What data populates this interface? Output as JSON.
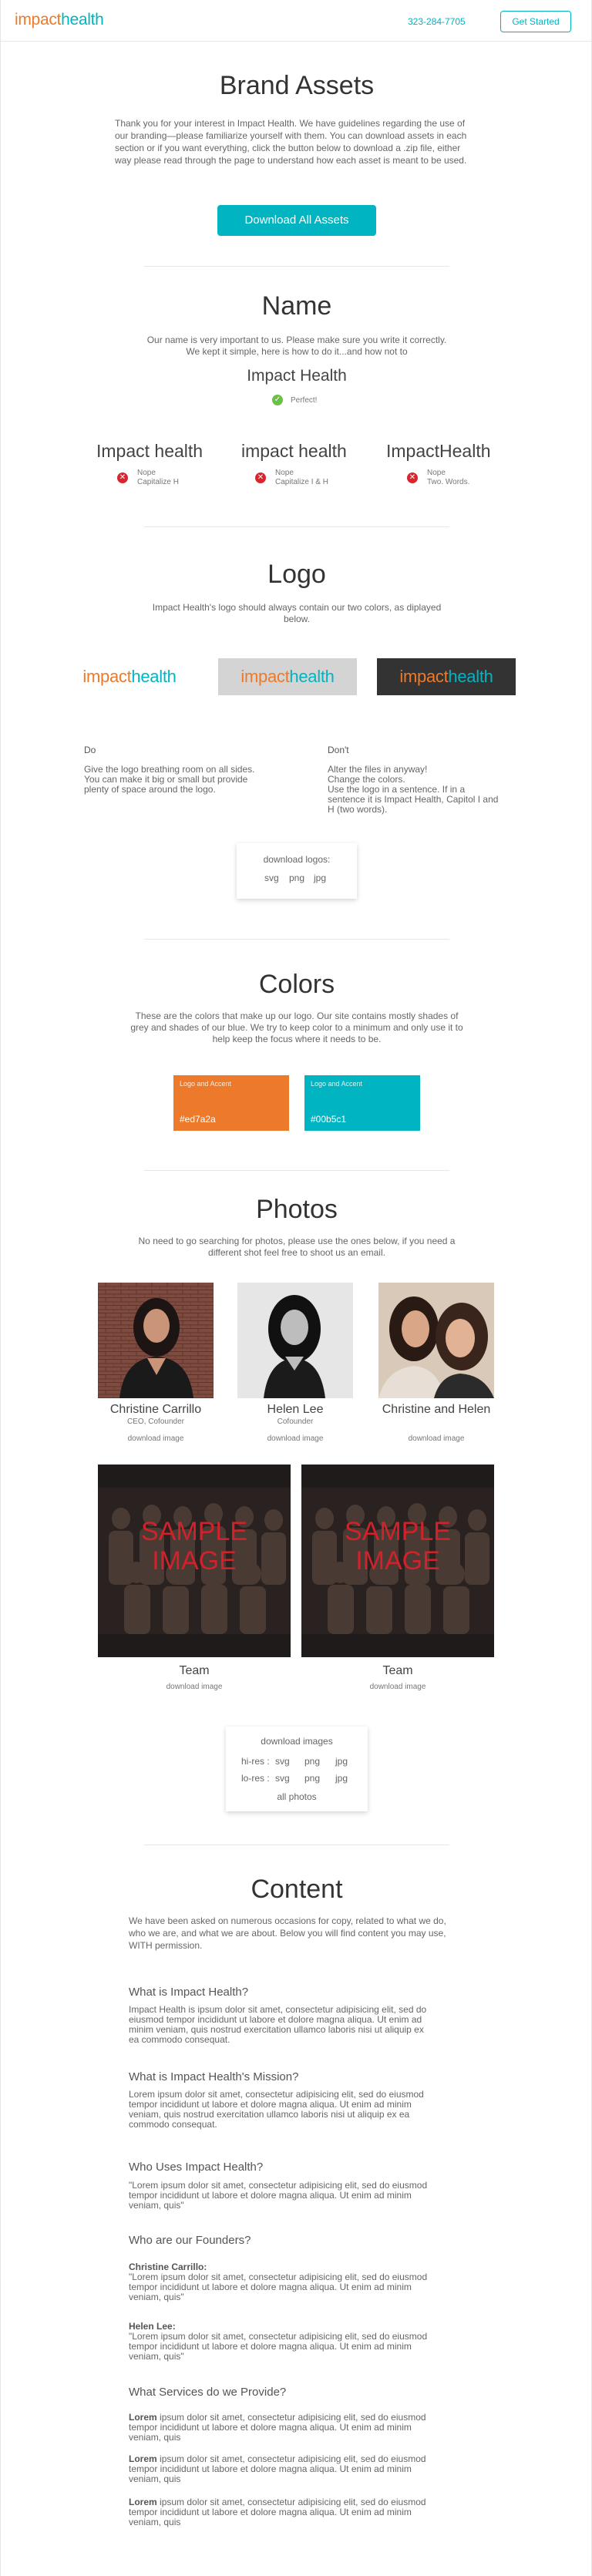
{
  "header": {
    "logo_part1": "impact",
    "logo_part2": "health",
    "phone": "323-284-7705",
    "cta_label": "Get Started"
  },
  "brand": {
    "title": "Brand Assets",
    "intro": "Thank you for your interest in Impact Health. We have guidelines regarding the use of our branding—please familiarize yourself with them. You can download assets in each section or if you want everything, click the button below to download a .zip file, either way please read through the page to understand how each asset is meant to be used.",
    "download_all_label": "Download All Assets"
  },
  "name_section": {
    "title": "Name",
    "intro": "Our name is very important to us. Please make sure you write it correctly. We kept it simple, here is how to do it...and how not to",
    "correct": "Impact Health",
    "correct_note": "Perfect!",
    "wrong": [
      {
        "text": "Impact health",
        "verdict": "Nope",
        "reason": "Capitalize H"
      },
      {
        "text": "impact health",
        "verdict": "Nope",
        "reason": "Capitalize I & H"
      },
      {
        "text": "ImpactHealth",
        "verdict": "Nope",
        "reason": "Two. Words."
      }
    ]
  },
  "logo_section": {
    "title": "Logo",
    "intro": "Impact Health's logo should always contain our two colors, as diplayed below.",
    "logo_part1": "impact",
    "logo_part2": "health",
    "do_heading": "Do",
    "do_text": "Give the logo breathing room on all sides. You can make it big or small but provide plenty of space around the logo.",
    "dont_heading": "Don't",
    "dont_lines": [
      "Alter the files in anyway!",
      "Change the colors.",
      "Use the logo in a sentence. If in a sentence it is Impact Health, Capitol I and H (two words)."
    ],
    "download_title": "download logos:",
    "formats": [
      "svg",
      "png",
      "jpg"
    ]
  },
  "colors_section": {
    "title": "Colors",
    "intro": "These are the colors that make up our logo. Our site contains mostly shades of grey and shades of our blue. We try to keep color to a minimum and only use it to help keep the focus where it needs to be.",
    "swatches": [
      {
        "label": "Logo and Accent",
        "hex": "#ed7a2a",
        "color": "#ed7a2a"
      },
      {
        "label": "Logo and Accent",
        "hex": "#00b5c1",
        "color": "#00b5c1"
      }
    ]
  },
  "photos_section": {
    "title": "Photos",
    "intro": "No need to go searching for photos, please use the ones below, if you need a different shot feel free to shoot us an email.",
    "people": [
      {
        "name": "Christine Carrillo",
        "role": "CEO, Cofounder",
        "download": "download image"
      },
      {
        "name": "Helen Lee",
        "role": "Cofounder",
        "download": "download image"
      },
      {
        "name": "Christine and Helen",
        "role": "",
        "download": "download image"
      }
    ],
    "teams": [
      {
        "stamp": "SAMPLE IMAGE",
        "name": "Team",
        "download": "download image"
      },
      {
        "stamp": "SAMPLE IMAGE",
        "name": "Team",
        "download": "download image"
      }
    ],
    "download_box": {
      "title": "download images",
      "hires_label": "hi-res :",
      "lores_label": "lo-res :",
      "formats": [
        "svg",
        "png",
        "jpg"
      ],
      "all": "all photos"
    }
  },
  "content_section": {
    "title": "Content",
    "intro": "We have been asked on numerous occasions for copy, related to what we do, who we are, and what we are about. Below you will find content you may use, WITH permission.",
    "q1": "What is Impact Health?",
    "a1": "Impact Health is ipsum dolor sit amet, consectetur adipisicing elit, sed do eiusmod tempor incididunt ut labore et dolore magna aliqua. Ut enim ad minim veniam, quis nostrud exercitation ullamco laboris nisi ut aliquip ex ea commodo consequat.",
    "q2": "What is Impact Health's Mission?",
    "a2": "Lorem ipsum dolor sit amet, consectetur adipisicing elit, sed do eiusmod tempor incididunt ut labore et dolore magna aliqua. Ut enim ad minim veniam, quis nostrud exercitation ullamco laboris nisi ut aliquip ex ea commodo consequat.",
    "q3": "Who Uses Impact Health?",
    "a3": "\"Lorem ipsum dolor sit amet, consectetur adipisicing elit, sed do eiusmod tempor incididunt ut labore et dolore magna aliqua. Ut enim ad minim veniam, quis\"",
    "q4": "Who are our Founders?",
    "founder1_name": "Christine Carrillo:",
    "founder1_text": "\"Lorem ipsum dolor sit amet, consectetur adipisicing elit, sed do eiusmod tempor incididunt ut labore et dolore magna aliqua. Ut enim ad minim veniam, quis\"",
    "founder2_name": "Helen Lee:",
    "founder2_text": "\"Lorem ipsum dolor sit amet, consectetur adipisicing elit, sed do eiusmod tempor incididunt ut labore et dolore magna aliqua. Ut enim ad minim veniam, quis\"",
    "q5": "What Services do we Provide?",
    "services": [
      {
        "lead": "Lorem",
        "text": "ipsum dolor sit amet, consectetur adipisicing elit, sed do eiusmod tempor incididunt ut labore et dolore magna aliqua. Ut enim ad minim veniam, quis"
      },
      {
        "lead": "Lorem",
        "text": "ipsum dolor sit amet, consectetur adipisicing elit, sed do eiusmod tempor incididunt ut labore et dolore magna aliqua. Ut enim ad minim veniam, quis"
      },
      {
        "lead": "Lorem",
        "text": "ipsum dolor sit amet, consectetur adipisicing elit, sed do eiusmod tempor incididunt ut labore et dolore magna aliqua. Ut enim ad minim veniam, quis"
      }
    ]
  },
  "colors": {
    "orange": "#ed7a2a",
    "teal": "#00b5c1",
    "check": "#6cc04a",
    "cross": "#d9262e"
  }
}
